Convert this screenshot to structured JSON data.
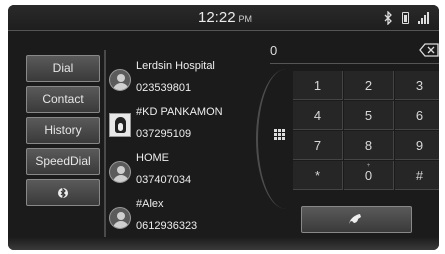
{
  "statusbar": {
    "time": "12:22",
    "ampm": "PM",
    "icons": [
      "bluetooth-icon",
      "battery-icon",
      "signal-icon"
    ]
  },
  "sidebar": {
    "items": [
      {
        "label": "Dial"
      },
      {
        "label": "Contact"
      },
      {
        "label": "History"
      },
      {
        "label": "SpeedDial"
      },
      {
        "icon": "bluetooth-icon"
      }
    ]
  },
  "contacts": [
    {
      "name": "Lerdsin Hospital",
      "number": "023539801",
      "avatar": "person-icon"
    },
    {
      "name": "#KD PANKAMON",
      "number": "037295109",
      "avatar": "photo"
    },
    {
      "name": "HOME",
      "number": "037407034",
      "avatar": "person-icon"
    },
    {
      "name": "#Alex",
      "number": "0612936323",
      "avatar": "person-icon"
    }
  ],
  "dialer": {
    "display": "0",
    "keys": [
      {
        "main": "1",
        "sub": ""
      },
      {
        "main": "2",
        "sub": ""
      },
      {
        "main": "3",
        "sub": ""
      },
      {
        "main": "4",
        "sub": ""
      },
      {
        "main": "5",
        "sub": ""
      },
      {
        "main": "6",
        "sub": ""
      },
      {
        "main": "7",
        "sub": ""
      },
      {
        "main": "8",
        "sub": ""
      },
      {
        "main": "9",
        "sub": ""
      },
      {
        "main": "*",
        "sub": ""
      },
      {
        "main": "0",
        "sub": "+"
      },
      {
        "main": "#",
        "sub": ""
      }
    ],
    "call_icon": "phone-icon"
  },
  "colors": {
    "background": "#1b1b1b",
    "button": "#4a4a4a",
    "text": "#eeeeee"
  }
}
